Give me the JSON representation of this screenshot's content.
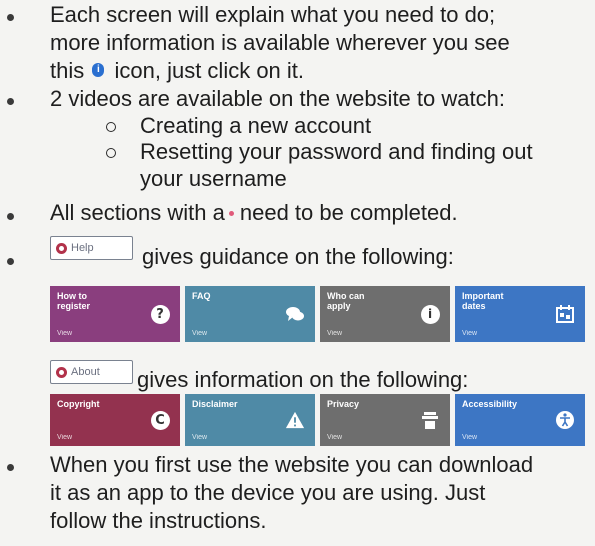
{
  "bullets": {
    "b1_l1": "Each screen will explain what you need to do;",
    "b1_l2": "more information is available wherever you see",
    "b1_l3a": "this",
    "b1_l3b": "icon, just click on it.",
    "b2": "2 videos are available on the website to watch:",
    "sub1": "Creating a new account",
    "sub2_l1": "Resetting your password and finding out",
    "sub2_l2": "your username",
    "b3a": "All sections with a",
    "b3b": "need to be completed.",
    "b4": "gives guidance on the following:",
    "b5": "gives information on the following:",
    "b6_l1": "When you first use the website you can download",
    "b6_l2": "it as an app to the device you are using. Just",
    "b6_l3": "follow the instructions."
  },
  "help_button": {
    "label": "Help"
  },
  "about_button": {
    "label": "About"
  },
  "help_tiles": [
    {
      "title": "How to register",
      "view": "View",
      "color": "#8a3e7e",
      "icon": "question-icon"
    },
    {
      "title": "FAQ",
      "view": "View",
      "color": "#4f8aa6",
      "icon": "chat-icon"
    },
    {
      "title": "Who can apply",
      "view": "View",
      "color": "#6e6e6e",
      "icon": "info-icon"
    },
    {
      "title": "Important dates",
      "view": "View",
      "color": "#3d76c4",
      "icon": "calendar-icon"
    }
  ],
  "about_tiles": [
    {
      "title": "Copyright",
      "view": "View",
      "color": "#93324f",
      "icon": "copyright-icon"
    },
    {
      "title": "Disclaimer",
      "view": "View",
      "color": "#4f8aa6",
      "icon": "warning-icon"
    },
    {
      "title": "Privacy",
      "view": "View",
      "color": "#6e6e6e",
      "icon": "privacy-icon"
    },
    {
      "title": "Accessibility",
      "view": "View",
      "color": "#3d76c4",
      "icon": "accessibility-icon"
    }
  ]
}
